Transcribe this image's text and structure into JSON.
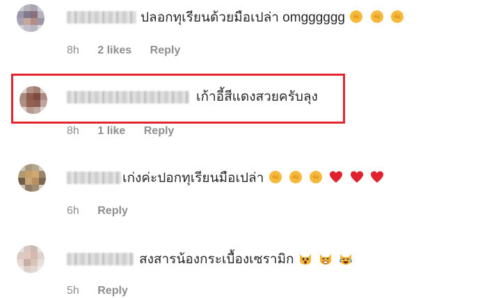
{
  "comments": [
    {
      "text": "ปลอกทุเรียนด้วยมือเปล่า omgggggg",
      "emoji": [
        "clap",
        "clap",
        "clap"
      ],
      "time": "8h",
      "likes": "2 likes",
      "reply": "Reply"
    },
    {
      "text": "เก้าอี้สีแดงสวยครับลุง",
      "emoji": [],
      "time": "8h",
      "likes": "1 like",
      "reply": "Reply",
      "highlighted": true
    },
    {
      "text": "เก่งค่ะปอกทุเรียนมือเปล่า",
      "emoji": [
        "clap",
        "clap",
        "clap",
        "heart",
        "heart",
        "heart"
      ],
      "time": "6h",
      "likes": "",
      "reply": "Reply"
    },
    {
      "text": "สงสารน้องกระเบื้องเซรามิก",
      "emoji": [
        "scream-cat",
        "grin-cat",
        "joy-cat"
      ],
      "time": "5h",
      "likes": "",
      "reply": "Reply"
    }
  ],
  "colors": {
    "highlight_border": "#e3262d",
    "meta_text": "#8e8e8e",
    "body_text": "#262626"
  }
}
